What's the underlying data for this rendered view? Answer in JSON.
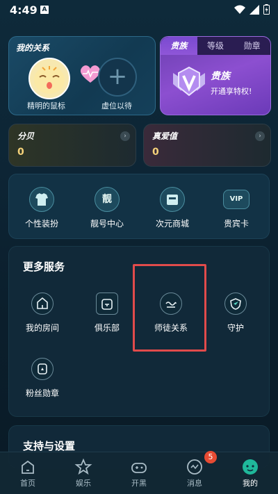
{
  "status": {
    "time": "4:49",
    "notif_icon": "A"
  },
  "relationship": {
    "title": "我的关系",
    "user_name": "精明的鼠标",
    "empty_slot": "虚位以待"
  },
  "noble": {
    "tabs": [
      "贵族",
      "等级",
      "勋章"
    ],
    "title": "贵族",
    "subtitle": "开通享特权!"
  },
  "stats": {
    "left": {
      "label": "分贝",
      "value": "0"
    },
    "right": {
      "label": "真爱值",
      "value": "0"
    }
  },
  "quick": [
    {
      "label": "个性装扮",
      "icon": "shirt-icon"
    },
    {
      "label": "靓号中心",
      "icon": "pretty-number-icon",
      "glyph": "靓"
    },
    {
      "label": "次元商城",
      "icon": "store-icon"
    },
    {
      "label": "贵宾卡",
      "icon": "vip-card-icon",
      "glyph": "VIP"
    }
  ],
  "services": {
    "title": "更多服务",
    "items": [
      {
        "label": "我的房间",
        "icon": "home-icon"
      },
      {
        "label": "俱乐部",
        "icon": "club-icon"
      },
      {
        "label": "师徒关系",
        "icon": "mentor-icon"
      },
      {
        "label": "守护",
        "icon": "shield-icon"
      },
      {
        "label": "粉丝勋章",
        "icon": "fan-medal-icon"
      }
    ]
  },
  "support": {
    "title": "支持与设置"
  },
  "tabbar": {
    "items": [
      {
        "label": "首页",
        "icon": "home-tab-icon"
      },
      {
        "label": "娱乐",
        "icon": "star-tab-icon"
      },
      {
        "label": "开黑",
        "icon": "gamepad-tab-icon"
      },
      {
        "label": "消息",
        "icon": "message-tab-icon",
        "badge": "5"
      },
      {
        "label": "我的",
        "icon": "profile-tab-icon"
      }
    ],
    "active": "我的"
  }
}
